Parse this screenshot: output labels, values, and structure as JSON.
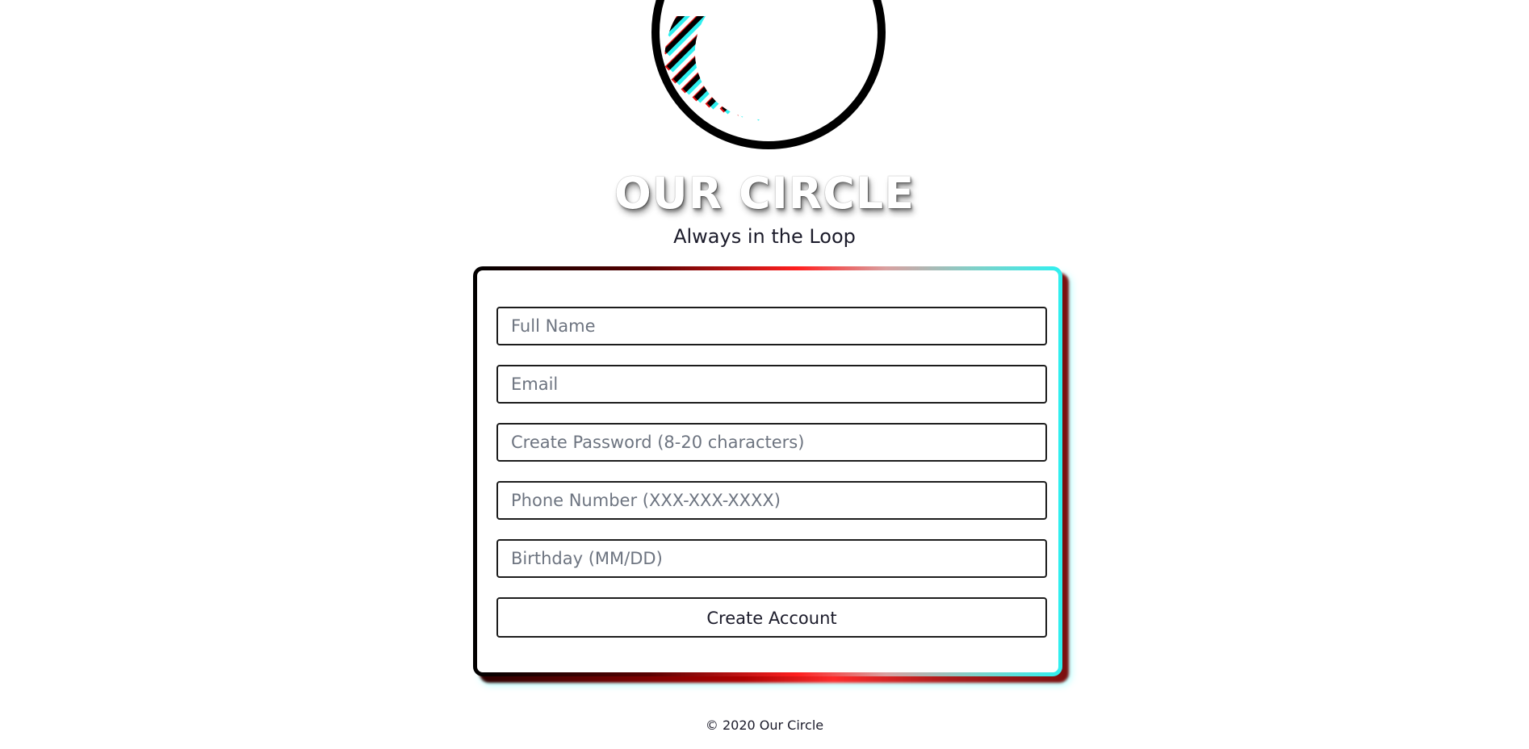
{
  "brand": {
    "title": "OUR CIRCLE",
    "tagline": "Always in the Loop",
    "logo_icon": "circle-logo-icon"
  },
  "form": {
    "fields": [
      {
        "name": "full-name-input",
        "placeholder": "Full Name",
        "value": ""
      },
      {
        "name": "email-input",
        "placeholder": "Email",
        "value": ""
      },
      {
        "name": "password-input",
        "placeholder": "Create Password (8-20 characters)",
        "value": ""
      },
      {
        "name": "phone-input",
        "placeholder": "Phone Number (XXX-XXX-XXXX)",
        "value": ""
      },
      {
        "name": "birthday-input",
        "placeholder": "Birthday (MM/DD)",
        "value": ""
      }
    ],
    "submit_label": "Create Account"
  },
  "footer": {
    "text": "© 2020 Our Circle"
  },
  "colors": {
    "accent_red": "#ff1f1f",
    "accent_cyan": "#2ff0f0",
    "text_dark": "#1b1b2a",
    "placeholder": "#6d7480"
  }
}
